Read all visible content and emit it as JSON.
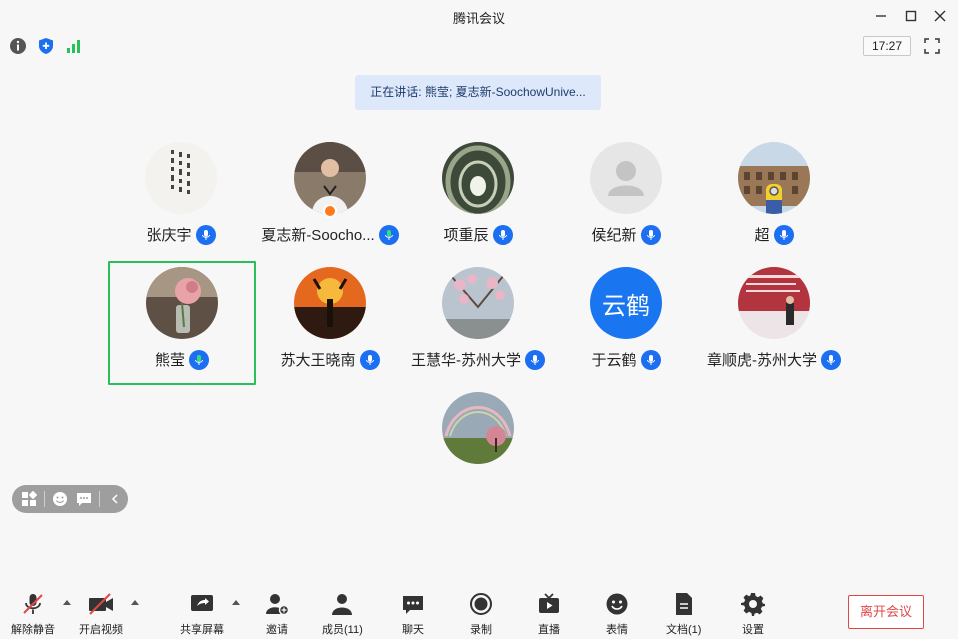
{
  "window": {
    "title": "腾讯会议"
  },
  "infobar": {
    "time": "17:27"
  },
  "speaking_banner": "正在讲话: 熊莹; 夏志新-SoochowUnive...",
  "participants": [
    {
      "name": "张庆宇",
      "mic": "on"
    },
    {
      "name": "夏志新-Soocho...",
      "mic": "active",
      "host": true
    },
    {
      "name": "项重辰",
      "mic": "on"
    },
    {
      "name": "侯纪新",
      "mic": "on"
    },
    {
      "name": "超",
      "mic": "on"
    },
    {
      "name": "熊莹",
      "mic": "active",
      "selected": true
    },
    {
      "name": "苏大王晓南",
      "mic": "on"
    },
    {
      "name": "王慧华-苏州大学",
      "mic": "on"
    },
    {
      "name": "于云鹤",
      "mic": "on",
      "avatar_text": "云鹤"
    },
    {
      "name": "章顺虎-苏州大学",
      "mic": "on"
    },
    {
      "name": "",
      "mic": "none"
    }
  ],
  "toolbar": {
    "unmute": "解除静音",
    "start_video": "开启视频",
    "share_screen": "共享屏幕",
    "invite": "邀请",
    "members": "成员(11)",
    "chat": "聊天",
    "record": "录制",
    "live": "直播",
    "reactions": "表情",
    "docs": "文档(1)",
    "settings": "设置",
    "leave": "离开会议"
  },
  "colors": {
    "accent": "#1c6ff0",
    "active_border": "#2bbf5c",
    "leave": "#e04848"
  }
}
